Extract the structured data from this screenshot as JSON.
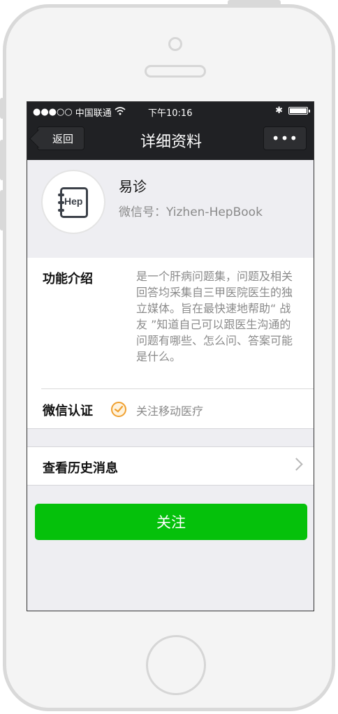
{
  "status_bar": {
    "signal": "●●●○○",
    "carrier": "中国联通",
    "wifi_icon": "wifi-icon",
    "time": "下午10:16",
    "bluetooth": "✱"
  },
  "nav": {
    "back_label": "返回",
    "title": "详细资料",
    "more_label": "•••"
  },
  "profile": {
    "avatar_text": "Hep",
    "name": "易诊",
    "wechat_id": "微信号：Yizhen-HepBook"
  },
  "info": {
    "intro_label": "功能介绍",
    "intro_text": "是一个肝病问题集，问题及相关回答均采集自三甲医院医生的独立媒体。旨在最快速地帮助“ 战友 ”知道自己可以跟医生沟通的问题有哪些、怎么问、答案可能是什么。",
    "verify_label": "微信认证",
    "verify_text": "关注移动医疗"
  },
  "history": {
    "label": "查看历史消息"
  },
  "actions": {
    "follow_label": "关注"
  },
  "colors": {
    "nav_bg": "#202124",
    "follow_button": "#05c10b",
    "verify_badge": "#f0a030"
  }
}
